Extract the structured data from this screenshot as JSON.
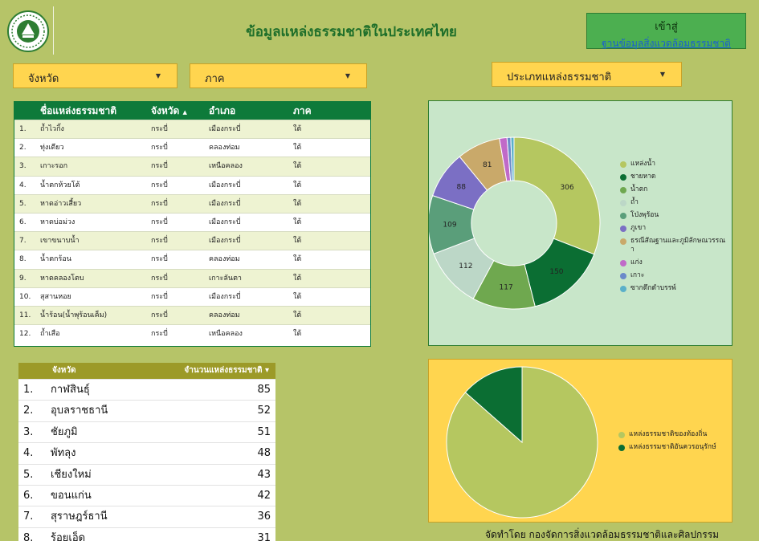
{
  "header": {
    "title": "ข้อมูลแหล่งธรรมชาติในประเทศไทย",
    "gateway_line1": "เข้าสู่",
    "gateway_line2": "ฐานข้อมูลสิ่งแวดล้อมธรรมชาติ"
  },
  "filters": {
    "province": "จังหวัด",
    "region": "ภาค",
    "site_type": "ประเภทแหล่งธรรมชาติ"
  },
  "sites_table": {
    "headers": {
      "name": "ชื่อแหล่งธรรมชาติ",
      "province": "จังหวัด",
      "sort_indicator": "▲",
      "district": "อำเภอ",
      "region": "ภาค"
    },
    "rows": [
      {
        "no": "1.",
        "name": "ถ้ำไวกิ้ง",
        "province": "กระบี่",
        "district": "เมืองกระบี่",
        "region": "ใต้"
      },
      {
        "no": "2.",
        "name": "ทุ่งเตียว",
        "province": "กระบี่",
        "district": "คลองท่อม",
        "region": "ใต้"
      },
      {
        "no": "3.",
        "name": "เกาะรอก",
        "province": "กระบี่",
        "district": "เหนือคลอง",
        "region": "ใต้"
      },
      {
        "no": "4.",
        "name": "น้ำตกห้วยโต้",
        "province": "กระบี่",
        "district": "เมืองกระบี่",
        "region": "ใต้"
      },
      {
        "no": "5.",
        "name": "หาดอ่าวเสี้ยว",
        "province": "กระบี่",
        "district": "เมืองกระบี่",
        "region": "ใต้"
      },
      {
        "no": "6.",
        "name": "หาดบ่อม่วง",
        "province": "กระบี่",
        "district": "เมืองกระบี่",
        "region": "ใต้"
      },
      {
        "no": "7.",
        "name": "เขาขนาบน้ำ",
        "province": "กระบี่",
        "district": "เมืองกระบี่",
        "region": "ใต้"
      },
      {
        "no": "8.",
        "name": "น้ำตกร้อน",
        "province": "กระบี่",
        "district": "คลองท่อม",
        "region": "ใต้"
      },
      {
        "no": "9.",
        "name": "หาดคลองโตบ",
        "province": "กระบี่",
        "district": "เกาะลันตา",
        "region": "ใต้"
      },
      {
        "no": "10.",
        "name": "สุสานหอย",
        "province": "กระบี่",
        "district": "เมืองกระบี่",
        "region": "ใต้"
      },
      {
        "no": "11.",
        "name": "น้ำร้อน(น้ำพุร้อนเค็ม)",
        "province": "กระบี่",
        "district": "คลองท่อม",
        "region": "ใต้"
      },
      {
        "no": "12.",
        "name": "ถ้ำเสือ",
        "province": "กระบี่",
        "district": "เหนือคลอง",
        "region": "ใต้"
      }
    ]
  },
  "province_table": {
    "headers": {
      "province": "จังหวัด",
      "count": "จำนวนแหล่งธรรมชาติ ▾"
    },
    "rows": [
      {
        "no": "1.",
        "name": "กาฬสินธุ์",
        "value": "85"
      },
      {
        "no": "2.",
        "name": "อุบลราชธานี",
        "value": "52"
      },
      {
        "no": "3.",
        "name": "ชัยภูมิ",
        "value": "51"
      },
      {
        "no": "4.",
        "name": "พัทลุง",
        "value": "48"
      },
      {
        "no": "5.",
        "name": "เชียงใหม่",
        "value": "43"
      },
      {
        "no": "6.",
        "name": "ขอนแก่น",
        "value": "42"
      },
      {
        "no": "7.",
        "name": "สุราษฎร์ธานี",
        "value": "36"
      },
      {
        "no": "8.",
        "name": "ร้อยเอ็ด",
        "value": "31"
      }
    ]
  },
  "chart_data": [
    {
      "type": "pie",
      "donut": true,
      "labels": [
        "แหล่งน้ำ",
        "ชายหาด",
        "น้ำตก",
        "ถ้ำ",
        "โป่งพุร้อน",
        "ภูเขา",
        "ธรณีสัณฐานและภูมิลักษณวรรณา",
        "แก่ง",
        "เกาะ",
        "ซากดึกดำบรรพ์"
      ],
      "values": [
        306,
        150,
        117,
        112,
        109,
        88,
        81,
        14,
        7,
        6
      ],
      "value_labels": [
        "306",
        "150",
        "117",
        "112",
        "109",
        "88",
        "81",
        "",
        "",
        ""
      ],
      "colors": [
        "#b5c760",
        "#0b6e33",
        "#6fa84f",
        "#bcd7c7",
        "#5a9e7a",
        "#7b6fc4",
        "#c9a96a",
        "#c06ac8",
        "#6b8ac9",
        "#5bb0c9"
      ],
      "legend_position": "right"
    },
    {
      "type": "pie",
      "labels": [
        "แหล่งธรรมชาติของท้องถิ่น",
        "แหล่งธรรมชาติอันควรอนุรักษ์"
      ],
      "values": [
        86.5,
        13.5
      ],
      "colors": [
        "#b5c760",
        "#0b6e33"
      ],
      "legend_position": "right"
    }
  ],
  "footer": {
    "credit": "จัดทำโดย กองจัดการสิ่งแวดล้อมธรรมชาติและศิลปกรรม"
  }
}
